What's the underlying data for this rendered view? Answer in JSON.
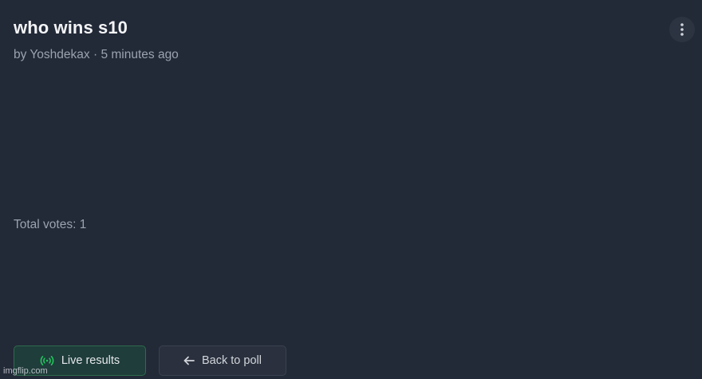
{
  "poll": {
    "title": "who wins s10",
    "meta": "by Yoshdekax · 5 minutes ago",
    "total_votes": "Total votes: 1"
  },
  "menu": {
    "icon": "more-vertical-icon"
  },
  "actions": {
    "live_results_label": "Live results",
    "live_results_icon": "broadcast-icon",
    "back_to_poll_label": "Back to poll",
    "back_to_poll_icon": "arrow-left-icon"
  },
  "watermark": "imgflip.com",
  "colors": {
    "background": "#222937",
    "live_accent": "#22c55e",
    "live_bg": "#1f3d3b"
  }
}
